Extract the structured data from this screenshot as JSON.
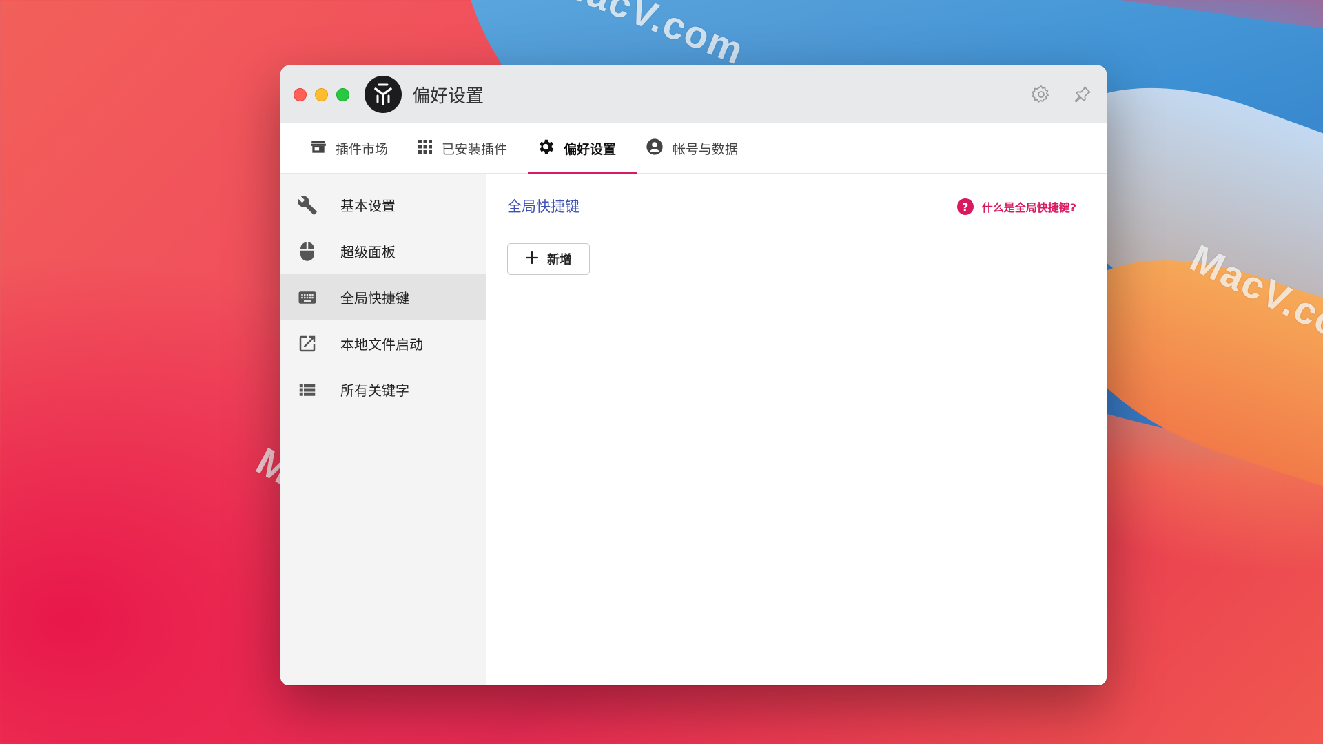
{
  "watermarks": [
    "MacV.com",
    "MacV.co",
    "MacV.com"
  ],
  "window": {
    "title": "偏好设置",
    "toolbar": {
      "settings_icon": "gear-icon",
      "pin_icon": "pin-icon"
    }
  },
  "tabs": [
    {
      "label": "插件市场",
      "icon": "store-icon",
      "active": false
    },
    {
      "label": "已安装插件",
      "icon": "grid-icon",
      "active": false
    },
    {
      "label": "偏好设置",
      "icon": "gear-icon",
      "active": true
    },
    {
      "label": "帐号与数据",
      "icon": "account-icon",
      "active": false
    }
  ],
  "sidebar": {
    "items": [
      {
        "label": "基本设置",
        "icon": "wrench-icon",
        "active": false
      },
      {
        "label": "超级面板",
        "icon": "mouse-icon",
        "active": false
      },
      {
        "label": "全局快捷键",
        "icon": "keyboard-icon",
        "active": true
      },
      {
        "label": "本地文件启动",
        "icon": "open-external-icon",
        "active": false
      },
      {
        "label": "所有关键字",
        "icon": "list-icon",
        "active": false
      }
    ]
  },
  "main": {
    "section_title": "全局快捷键",
    "help_link": "什么是全局快捷键?",
    "help_icon_glyph": "?",
    "add_button": "新增"
  },
  "colors": {
    "accent": "#d81b60",
    "section_title": "#3f51b5"
  }
}
